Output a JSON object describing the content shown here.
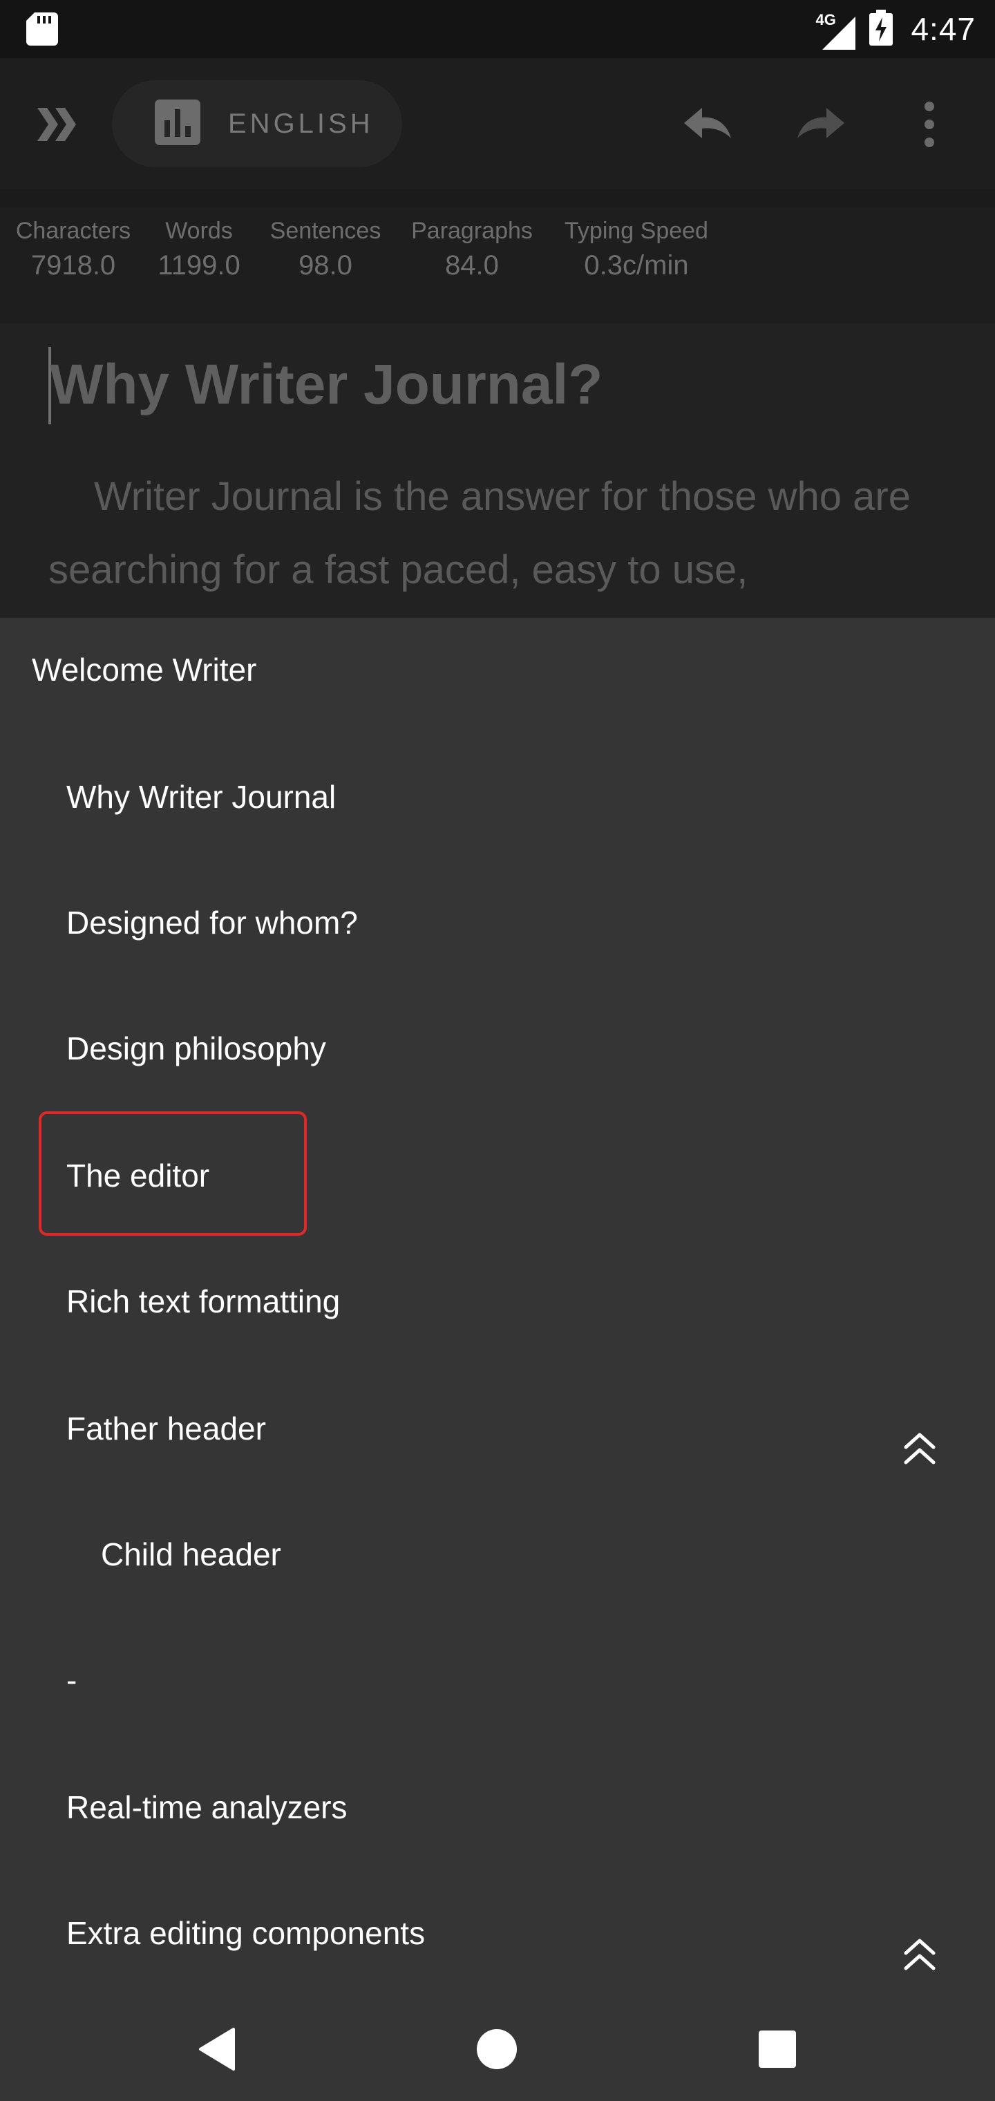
{
  "status_bar": {
    "network": "4G",
    "time": "4:47"
  },
  "app_bar": {
    "language": "ENGLISH"
  },
  "stats": [
    {
      "label": "Characters",
      "value": "7918.0"
    },
    {
      "label": "Words",
      "value": "1199.0"
    },
    {
      "label": "Sentences",
      "value": "98.0"
    },
    {
      "label": "Paragraphs",
      "value": "84.0"
    },
    {
      "label": "Typing Speed",
      "value": "0.3c/min"
    }
  ],
  "editor": {
    "title": "Why Writer Journal?",
    "body": "Writer Journal is the answer for those who are searching for a fast paced, easy to use,"
  },
  "outline": {
    "items": [
      {
        "label": "Welcome Writer",
        "level": 0
      },
      {
        "label": "Why Writer Journal",
        "level": 1
      },
      {
        "label": "Designed for whom?",
        "level": 1
      },
      {
        "label": "Design philosophy",
        "level": 1
      },
      {
        "label": "The editor",
        "level": 1,
        "highlighted": true
      },
      {
        "label": "Rich text formatting",
        "level": 1
      },
      {
        "label": "Father header",
        "level": 1
      },
      {
        "label": "Child header",
        "level": 2
      },
      {
        "label": "-",
        "level": 1
      },
      {
        "label": "Real-time analyzers",
        "level": 1
      },
      {
        "label": "Extra editing components",
        "level": 1
      }
    ]
  },
  "colors": {
    "sheet_background": "#353535",
    "highlight_border": "#e02828",
    "dim_text": "#6e6e6e"
  },
  "icons": {
    "status": [
      "sd-card-icon",
      "signal-icon",
      "battery-charging-icon"
    ],
    "app_bar": [
      "expand-icon",
      "stats-icon",
      "undo-icon",
      "redo-icon",
      "more-vert-icon"
    ],
    "sheet": [
      "scroll-up-icon"
    ],
    "navigation": [
      "back-icon",
      "home-icon",
      "recents-icon"
    ]
  }
}
